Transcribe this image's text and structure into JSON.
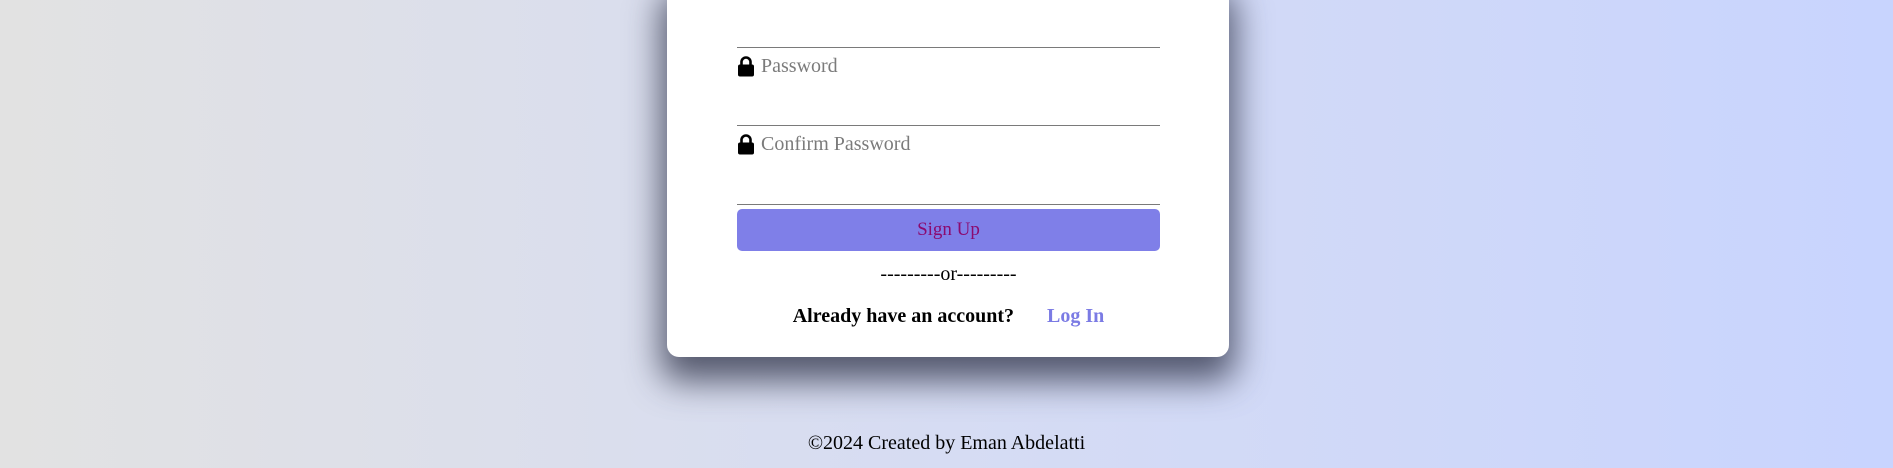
{
  "form": {
    "password_placeholder": "Password",
    "confirm_password_placeholder": "Confirm Password",
    "signup_label": "Sign Up",
    "divider": "---------or---------",
    "account_question": "Already have an account?",
    "login_label": "Log In"
  },
  "footer": {
    "text": "©2024 Created by Eman Abdelatti"
  },
  "icons": {
    "password": "lock-icon",
    "confirm_password": "lock-icon"
  },
  "colors": {
    "button_bg": "#7f7fe8",
    "button_text": "#8b0a6f",
    "link": "#7b7be4",
    "background_left": "#e2e2e2",
    "background_right": "#c8d4fe"
  }
}
